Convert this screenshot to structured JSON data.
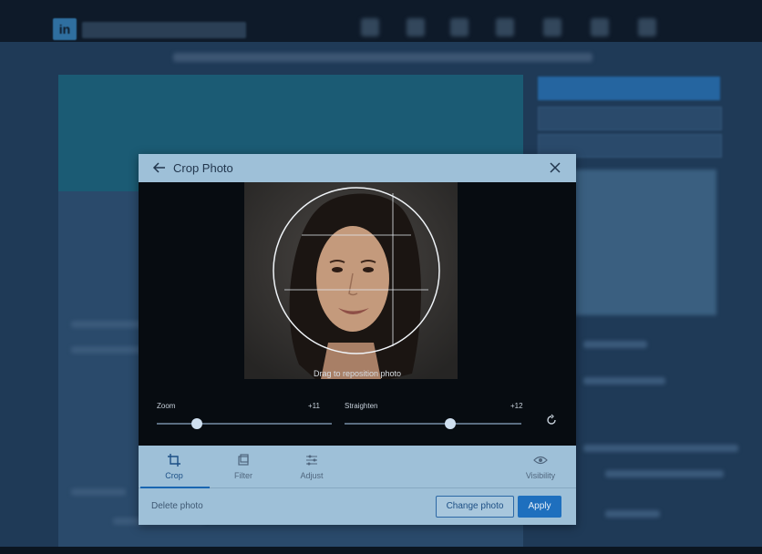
{
  "dialog": {
    "title": "Crop Photo",
    "drag_hint": "Drag to reposition photo"
  },
  "controls": {
    "zoom": {
      "label": "Zoom",
      "value_text": "+11",
      "level": 0.23
    },
    "straighten": {
      "label": "Straighten",
      "value_text": "+12",
      "level": 0.6
    }
  },
  "tabs": [
    {
      "label": "Crop",
      "icon": "crop-icon",
      "active": true
    },
    {
      "label": "Filter",
      "icon": "filter-icon",
      "active": false
    },
    {
      "label": "Adjust",
      "icon": "sliders-icon",
      "active": false
    },
    {
      "label": "Visibility",
      "icon": "eye-icon",
      "active": false
    }
  ],
  "footer": {
    "delete_label": "Delete photo",
    "change_label": "Change photo",
    "apply_label": "Apply"
  },
  "colors": {
    "accent": "#1e6fbe",
    "dialog_bg": "#9ec0d8",
    "stage_bg": "#070c11"
  }
}
